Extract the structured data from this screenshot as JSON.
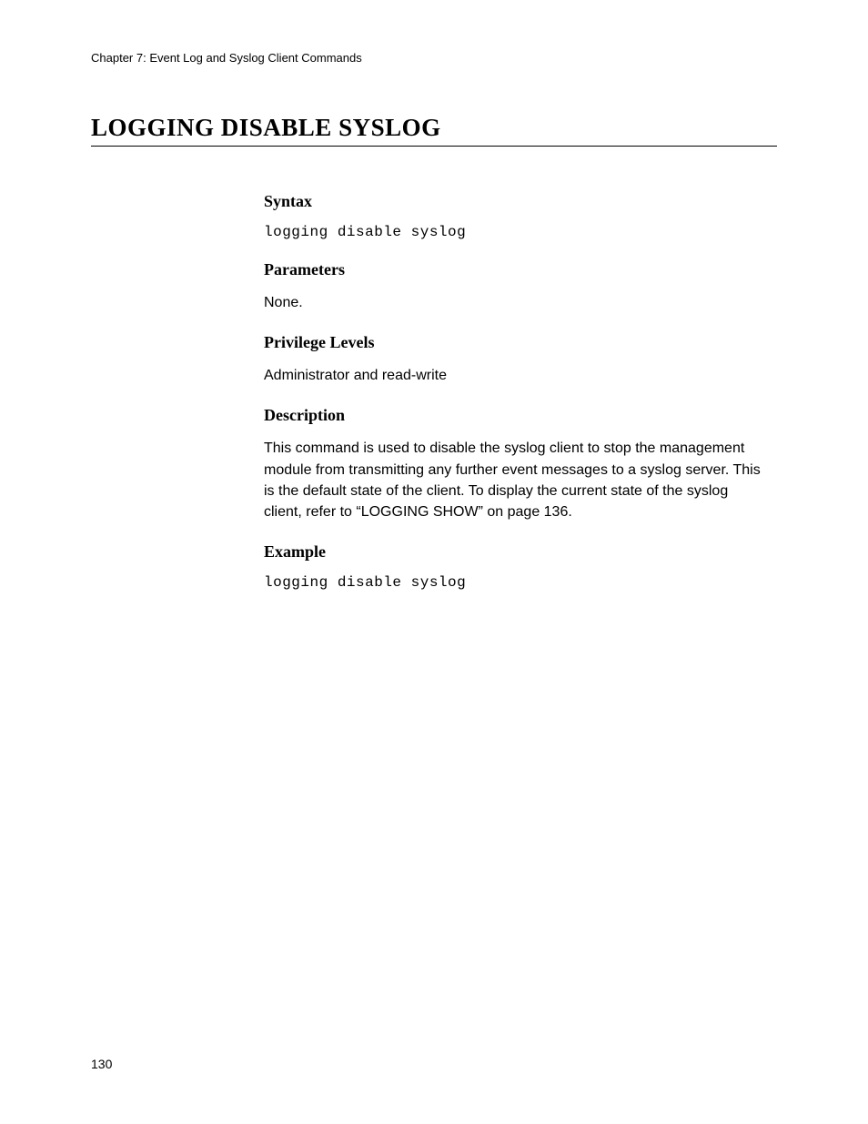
{
  "header": {
    "running_title": "Chapter 7: Event Log and Syslog Client Commands"
  },
  "title": "LOGGING DISABLE SYSLOG",
  "sections": {
    "syntax": {
      "heading": "Syntax",
      "code": "logging disable syslog"
    },
    "parameters": {
      "heading": "Parameters",
      "text": "None."
    },
    "privilege": {
      "heading": "Privilege Levels",
      "text": "Administrator and read-write"
    },
    "description": {
      "heading": "Description",
      "text": "This command is used to disable the syslog client to stop the management module from transmitting any further event messages to a syslog server. This is the default state of the client. To display the current state of the syslog client, refer to “LOGGING SHOW” on page 136."
    },
    "example": {
      "heading": "Example",
      "code": "logging disable syslog"
    }
  },
  "footer": {
    "page_number": "130"
  }
}
